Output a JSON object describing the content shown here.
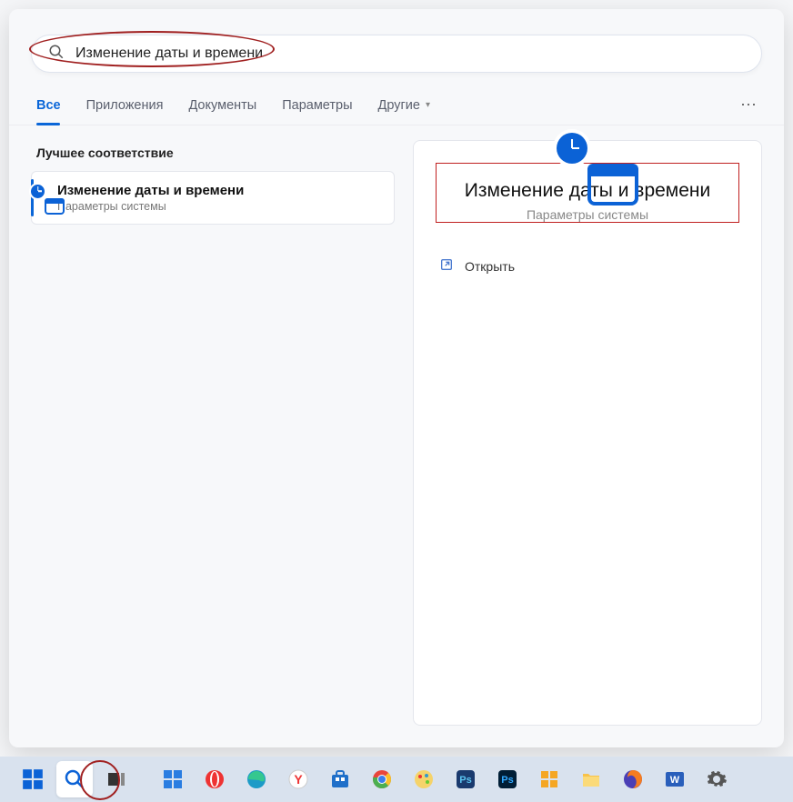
{
  "search": {
    "query": "Изменение даты и времени"
  },
  "tabs": {
    "all": "Все",
    "apps": "Приложения",
    "documents": "Документы",
    "settings": "Параметры",
    "more": "Другие"
  },
  "results": {
    "section_title": "Лучшее соответствие",
    "item": {
      "title": "Изменение даты и времени",
      "subtitle": "Параметры системы"
    }
  },
  "preview": {
    "title": "Изменение даты и времени",
    "subtitle": "Параметры системы",
    "action_open": "Открыть"
  },
  "taskbar": {
    "start": "start",
    "search": "search",
    "taskview": "task-view",
    "widgets": "widgets",
    "apps": [
      "opera",
      "edge",
      "yandex",
      "store",
      "chrome",
      "paint",
      "teams",
      "photoshop",
      "fences",
      "explorer",
      "firefox",
      "word",
      "settings"
    ]
  }
}
